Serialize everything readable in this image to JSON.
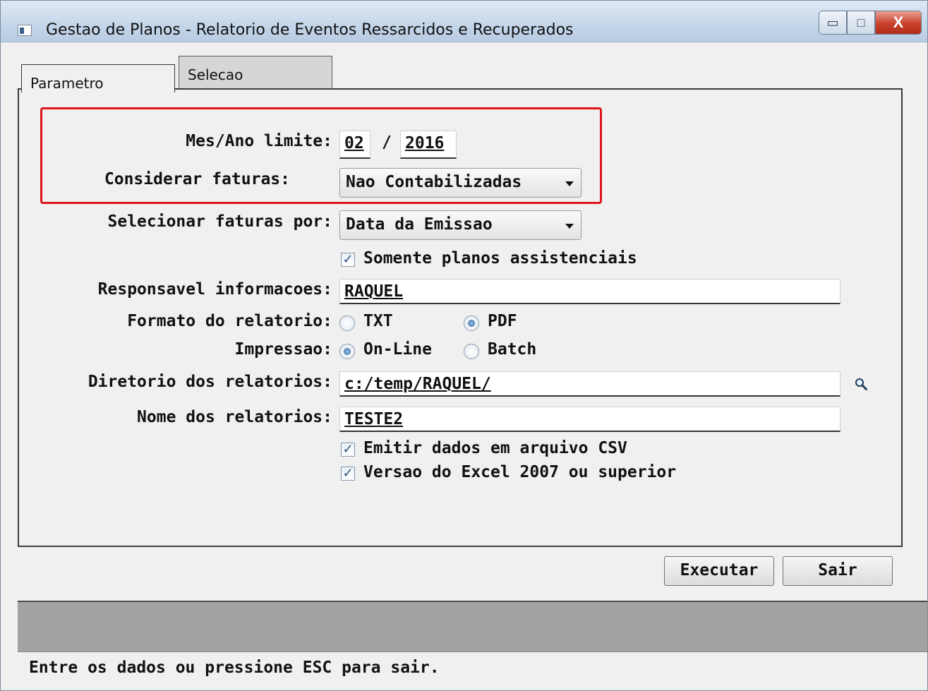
{
  "window": {
    "title": "Gestao de Planos - Relatorio de Eventos Ressarcidos e Recuperados",
    "close_symbol": "X"
  },
  "tabs": [
    {
      "label": "Parametro",
      "active": true
    },
    {
      "label": "Selecao",
      "active": false
    }
  ],
  "form": {
    "mes_ano_label": "Mes/Ano limite:",
    "mes_value": "02",
    "separator": "/",
    "ano_value": "2016",
    "considerar_label": "Considerar faturas:",
    "considerar_value": "Nao Contabilizadas",
    "selecionar_label": "Selecionar faturas por:",
    "selecionar_value": "Data da Emissao",
    "somente_planos_label": "Somente planos assistenciais",
    "somente_planos_checked": true,
    "responsavel_label": "Responsavel informacoes:",
    "responsavel_value": "RAQUEL",
    "formato_label": "Formato do relatorio:",
    "formato_options": [
      "TXT",
      "PDF"
    ],
    "formato_selected": "PDF",
    "impressao_label": "Impressao:",
    "impressao_options": [
      "On-Line",
      "Batch"
    ],
    "impressao_selected": "On-Line",
    "diretorio_label": "Diretorio dos relatorios:",
    "diretorio_value": "c:/temp/RAQUEL/",
    "nome_label": "Nome dos relatorios:",
    "nome_value": "TESTE2",
    "csv_label": "Emitir dados em arquivo CSV",
    "csv_checked": true,
    "excel_label": "Versao do Excel 2007 ou superior",
    "excel_checked": true
  },
  "buttons": {
    "executar": "Executar",
    "sair": "Sair"
  },
  "status_text": "Entre os dados ou pressione ESC para sair.",
  "colors": {
    "highlight_border": "#e0151b",
    "close_button": "#c8402c"
  }
}
